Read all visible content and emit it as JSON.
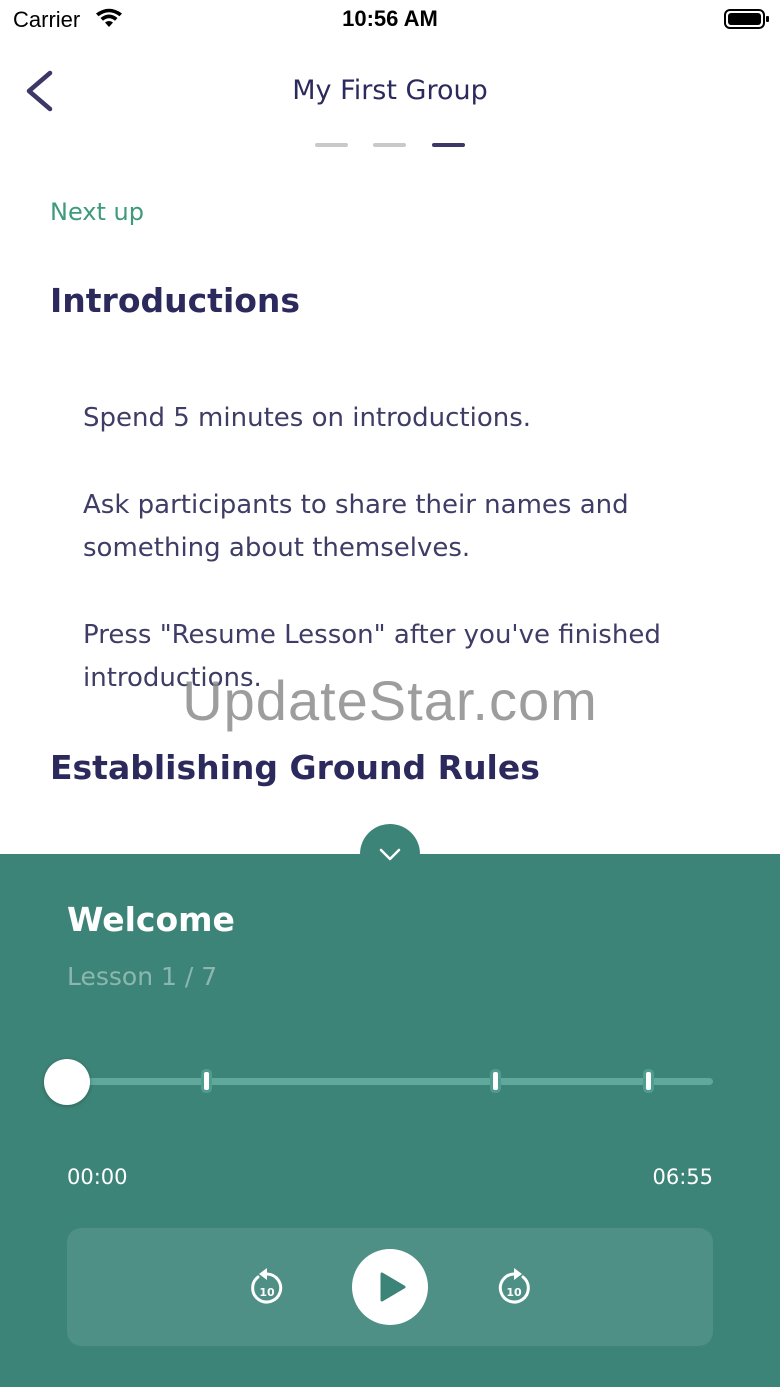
{
  "status_bar": {
    "carrier": "Carrier",
    "time": "10:56 AM"
  },
  "header": {
    "title": "My First Group",
    "back_icon": "chevron-left-icon",
    "pager": {
      "count": 3,
      "active_index": 2
    }
  },
  "content": {
    "next_up_label": "Next up",
    "sections": [
      {
        "title": "Introductions",
        "paragraphs": [
          "Spend 5 minutes on introductions.",
          "Ask participants to share their names and something about themselves.",
          "Press \"Resume Lesson\" after you've finished introductions."
        ]
      },
      {
        "title": "Establishing Ground Rules"
      }
    ]
  },
  "watermark": "UpdateStar.com",
  "player": {
    "lesson_title": "Welcome",
    "lesson_count": "Lesson 1 / 7",
    "time_current": "00:00",
    "time_total": "06:55",
    "progress_fraction": 0,
    "colors": {
      "panel": "#3d8478",
      "accent": "#3e9a7c",
      "text_primary": "#2c2a5c"
    },
    "icons": [
      "chevron-down-icon",
      "replay-10-icon",
      "play-icon",
      "forward-10-icon"
    ]
  }
}
